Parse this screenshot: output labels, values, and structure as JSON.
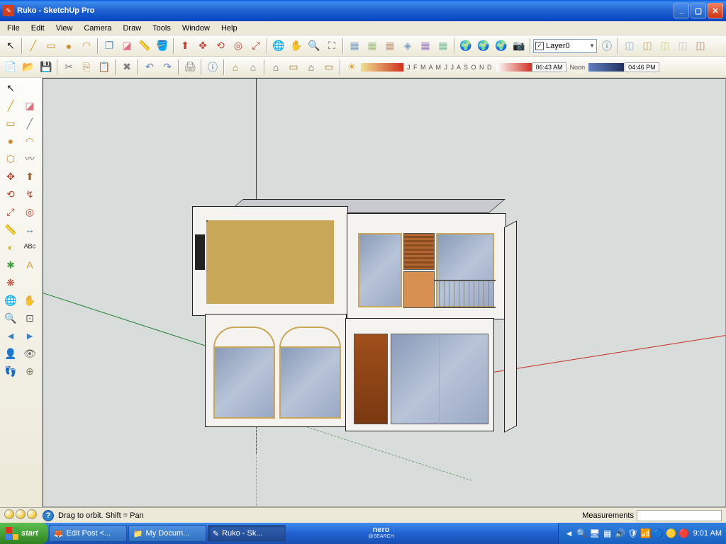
{
  "title": "Ruko - SketchUp Pro",
  "appicon": "✎",
  "menu": [
    "File",
    "Edit",
    "View",
    "Camera",
    "Draw",
    "Tools",
    "Window",
    "Help"
  ],
  "toolbar1": [
    {
      "name": "select-icon",
      "g": "↖",
      "c": "#222"
    },
    {
      "name": "sep",
      "g": "|"
    },
    {
      "name": "line-icon",
      "g": "╱",
      "c": "#D0A020"
    },
    {
      "name": "rectangle-icon",
      "g": "▭",
      "c": "#C89030"
    },
    {
      "name": "circle-icon",
      "g": "●",
      "c": "#C89030"
    },
    {
      "name": "arc-icon",
      "g": "◠",
      "c": "#C89030"
    },
    {
      "name": "sep",
      "g": "|"
    },
    {
      "name": "component-icon",
      "g": "❐",
      "c": "#6090C0"
    },
    {
      "name": "eraser-icon",
      "g": "◪",
      "c": "#E07080"
    },
    {
      "name": "tape-icon",
      "g": "📏",
      "c": "#D0B040"
    },
    {
      "name": "paint-icon",
      "g": "🪣",
      "c": "#C04030"
    },
    {
      "name": "sep",
      "g": "|"
    },
    {
      "name": "pushpull-icon",
      "g": "⬆",
      "c": "#C04030"
    },
    {
      "name": "move-icon",
      "g": "✥",
      "c": "#C04030"
    },
    {
      "name": "rotate-icon",
      "g": "⟲",
      "c": "#C04030"
    },
    {
      "name": "offset-icon",
      "g": "◎",
      "c": "#C04030"
    },
    {
      "name": "scale-icon",
      "g": "⤢",
      "c": "#C04030"
    },
    {
      "name": "sep",
      "g": "|"
    },
    {
      "name": "orbit-icon",
      "g": "🌐",
      "c": "#4080C0"
    },
    {
      "name": "pan-icon",
      "g": "✋",
      "c": "#E0B070"
    },
    {
      "name": "zoom-icon",
      "g": "🔍",
      "c": "#606060"
    },
    {
      "name": "zoomext-icon",
      "g": "⛶",
      "c": "#606060"
    },
    {
      "name": "sep",
      "g": "|"
    },
    {
      "name": "front-icon",
      "g": "▦",
      "c": "#80A0C0"
    },
    {
      "name": "back-icon",
      "g": "▦",
      "c": "#A0C080"
    },
    {
      "name": "top-icon",
      "g": "▦",
      "c": "#C0A080"
    },
    {
      "name": "iso-icon",
      "g": "◈",
      "c": "#80A0C0"
    },
    {
      "name": "side1-icon",
      "g": "▦",
      "c": "#A080C0"
    },
    {
      "name": "side2-icon",
      "g": "▦",
      "c": "#80C0A0"
    },
    {
      "name": "sep",
      "g": "|"
    },
    {
      "name": "ge-icon",
      "g": "🌍",
      "c": "#4060A0"
    },
    {
      "name": "ge2-icon",
      "g": "🌍",
      "c": "#4060A0"
    },
    {
      "name": "ge3-icon",
      "g": "🌍",
      "c": "#4060A0"
    },
    {
      "name": "ge4-icon",
      "g": "📷",
      "c": "#4060A0"
    },
    {
      "name": "sep",
      "g": "|"
    }
  ],
  "layer": {
    "label": "Layer0"
  },
  "infobtn": "ⓘ",
  "styles": [
    {
      "name": "shaded-icon",
      "g": "◫",
      "c": "#90B0D0"
    },
    {
      "name": "wire-icon",
      "g": "◫",
      "c": "#C0A060"
    },
    {
      "name": "hidden-icon",
      "g": "◫",
      "c": "#D0D070"
    },
    {
      "name": "xray-icon",
      "g": "◫",
      "c": "#C0C0C0"
    },
    {
      "name": "mono-icon",
      "g": "◫",
      "c": "#B08060"
    }
  ],
  "toolbar2": [
    {
      "name": "new-icon",
      "g": "📄",
      "c": "#E0E0C0"
    },
    {
      "name": "open-icon",
      "g": "📂",
      "c": "#E0C060"
    },
    {
      "name": "save-icon",
      "g": "💾",
      "c": "#4060C0"
    },
    {
      "name": "sep",
      "g": "|"
    },
    {
      "name": "cut-icon",
      "g": "✂",
      "c": "#808080"
    },
    {
      "name": "copy-icon",
      "g": "⎘",
      "c": "#C0A060"
    },
    {
      "name": "paste-icon",
      "g": "📋",
      "c": "#C0A060"
    },
    {
      "name": "sep",
      "g": "|"
    },
    {
      "name": "delete-icon",
      "g": "✖",
      "c": "#808080"
    },
    {
      "name": "sep",
      "g": "|"
    },
    {
      "name": "undo-icon",
      "g": "↶",
      "c": "#6080C0"
    },
    {
      "name": "redo-icon",
      "g": "↷",
      "c": "#6080C0"
    },
    {
      "name": "sep",
      "g": "|"
    },
    {
      "name": "print-icon",
      "g": "🖨",
      "c": "#808080"
    },
    {
      "name": "sep",
      "g": "|"
    },
    {
      "name": "info-icon",
      "g": "ⓘ",
      "c": "#3070C0"
    },
    {
      "name": "sep",
      "g": "|"
    },
    {
      "name": "house1-icon",
      "g": "⌂",
      "c": "#A08040"
    },
    {
      "name": "house2-icon",
      "g": "⌂",
      "c": "#808080"
    },
    {
      "name": "sep",
      "g": "|"
    },
    {
      "name": "house3-icon",
      "g": "⌂",
      "c": "#606060"
    },
    {
      "name": "house4-icon",
      "g": "▭",
      "c": "#A08040"
    },
    {
      "name": "house5-icon",
      "g": "⌂",
      "c": "#606060"
    },
    {
      "name": "house6-icon",
      "g": "▭",
      "c": "#A08040"
    },
    {
      "name": "sep",
      "g": "|"
    },
    {
      "name": "sun-icon",
      "g": "☀",
      "c": "#E0A030"
    }
  ],
  "months": "J F M A M J J A S O N D",
  "time1": "06:43 AM",
  "noon": "Noon",
  "time2": "04:46 PM",
  "leftTools": [
    {
      "name": "select-tool-icon",
      "g": "↖",
      "c": "#222"
    },
    {
      "name": "spacer",
      "g": ""
    },
    {
      "name": "line-tool-icon",
      "g": "╱",
      "c": "#D0A020"
    },
    {
      "name": "eraser-tool-icon",
      "g": "◪",
      "c": "#E07080"
    },
    {
      "name": "rect-tool-icon",
      "g": "▭",
      "c": "#C89030"
    },
    {
      "name": "line2-tool-icon",
      "g": "╱",
      "c": "#808080"
    },
    {
      "name": "circle-tool-icon",
      "g": "●",
      "c": "#C89030"
    },
    {
      "name": "arc-tool-icon",
      "g": "◠",
      "c": "#C89030"
    },
    {
      "name": "poly-tool-icon",
      "g": "⬡",
      "c": "#C89030"
    },
    {
      "name": "freehand-tool-icon",
      "g": "〰",
      "c": "#606060"
    },
    {
      "name": "move2-icon",
      "g": "✥",
      "c": "#C04030"
    },
    {
      "name": "pushpull2-icon",
      "g": "⬆",
      "c": "#A06030"
    },
    {
      "name": "rotate2-icon",
      "g": "⟲",
      "c": "#C04030"
    },
    {
      "name": "followme-icon",
      "g": "↯",
      "c": "#C04030"
    },
    {
      "name": "scale2-icon",
      "g": "⤢",
      "c": "#C04030"
    },
    {
      "name": "offset2-icon",
      "g": "◎",
      "c": "#C04030"
    },
    {
      "name": "tape2-icon",
      "g": "📏",
      "c": "#D0B040"
    },
    {
      "name": "dim-icon",
      "g": "↔",
      "c": "#4080C0"
    },
    {
      "name": "protractor-icon",
      "g": "◐",
      "c": "#D0B040"
    },
    {
      "name": "text-icon",
      "g": "ᴬᴮᶜ",
      "c": "#404040"
    },
    {
      "name": "axes-icon",
      "g": "✱",
      "c": "#40A040"
    },
    {
      "name": "3dtext-icon",
      "g": "A",
      "c": "#D0A030"
    },
    {
      "name": "section-icon",
      "g": "❋",
      "c": "#C04030"
    },
    {
      "name": "spacer",
      "g": ""
    },
    {
      "name": "orbit2-icon",
      "g": "🌐",
      "c": "#4080C0"
    },
    {
      "name": "pan2-icon",
      "g": "✋",
      "c": "#E0B070"
    },
    {
      "name": "zoom2-icon",
      "g": "🔍",
      "c": "#606060"
    },
    {
      "name": "zoomwin-icon",
      "g": "⊡",
      "c": "#606060"
    },
    {
      "name": "prev-icon",
      "g": "◄",
      "c": "#4080C0"
    },
    {
      "name": "next-icon",
      "g": "►",
      "c": "#4080C0"
    },
    {
      "name": "position-icon",
      "g": "👤",
      "c": "#606060"
    },
    {
      "name": "look-icon",
      "g": "👁",
      "c": "#606060"
    },
    {
      "name": "walk-icon",
      "g": "👣",
      "c": "#303030"
    },
    {
      "name": "cps-icon",
      "g": "⊕",
      "c": "#808060"
    }
  ],
  "status": {
    "hint": "Drag to orbit.  Shift = Pan",
    "meas": "Measurements"
  },
  "taskbar": {
    "start": "start",
    "items": [
      {
        "name": "firefox",
        "icon": "🦊",
        "label": "Edit Post <..."
      },
      {
        "name": "explorer",
        "icon": "📁",
        "label": "My Docum..."
      },
      {
        "name": "sketchup",
        "icon": "✎",
        "label": "Ruko - Sk...",
        "active": true
      }
    ],
    "nero": "nero",
    "nero2": "@SEARCH",
    "tray": [
      "◄",
      "🔍",
      "🖥",
      "▦",
      "🔊",
      "🛡",
      "📶",
      "🔵",
      "🟡",
      "🔴"
    ],
    "clock": "9:01 AM"
  }
}
